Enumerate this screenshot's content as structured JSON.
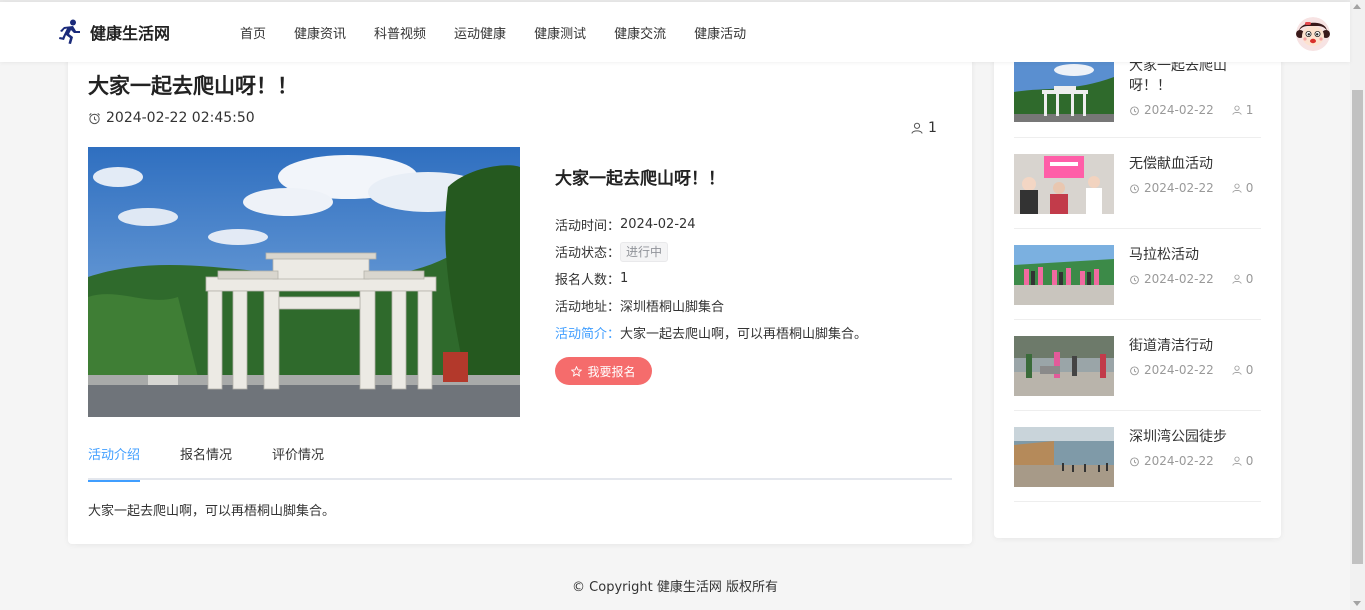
{
  "brand": {
    "name": "健康生活网"
  },
  "nav": {
    "items": [
      "首页",
      "健康资讯",
      "科普视频",
      "运动健康",
      "健康测试",
      "健康交流",
      "健康活动"
    ]
  },
  "activity": {
    "title": "大家一起去爬山呀！！",
    "datetime": "2024-02-22 02:45:50",
    "views": "1",
    "info_title": "大家一起去爬山呀！！",
    "time_label": "活动时间：",
    "time_value": "2024-02-24",
    "status_label": "活动状态：",
    "status_value": "进行中",
    "count_label": "报名人数：",
    "count_value": "1",
    "address_label": "活动地址：",
    "address_value": "深圳梧桐山脚集合",
    "intro_label": "活动简介：",
    "intro_value": "大家一起去爬山啊，可以再梧桐山脚集合。",
    "signup_label": "我要报名"
  },
  "tabs": [
    "活动介绍",
    "报名情况",
    "评价情况"
  ],
  "tab_content": "大家一起去爬山啊，可以再梧桐山脚集合。",
  "sidebar": {
    "items": [
      {
        "name": "大家一起去爬山呀！！",
        "date": "2024-02-22",
        "count": "1"
      },
      {
        "name": "无偿献血活动",
        "date": "2024-02-22",
        "count": "0"
      },
      {
        "name": "马拉松活动",
        "date": "2024-02-22",
        "count": "0"
      },
      {
        "name": "街道清洁行动",
        "date": "2024-02-22",
        "count": "0"
      },
      {
        "name": "深圳湾公园徒步",
        "date": "2024-02-22",
        "count": "0"
      }
    ]
  },
  "footer": "© Copyright 健康生活网 版权所有",
  "colors": {
    "accent": "#409eff",
    "danger": "#f56c6c"
  }
}
